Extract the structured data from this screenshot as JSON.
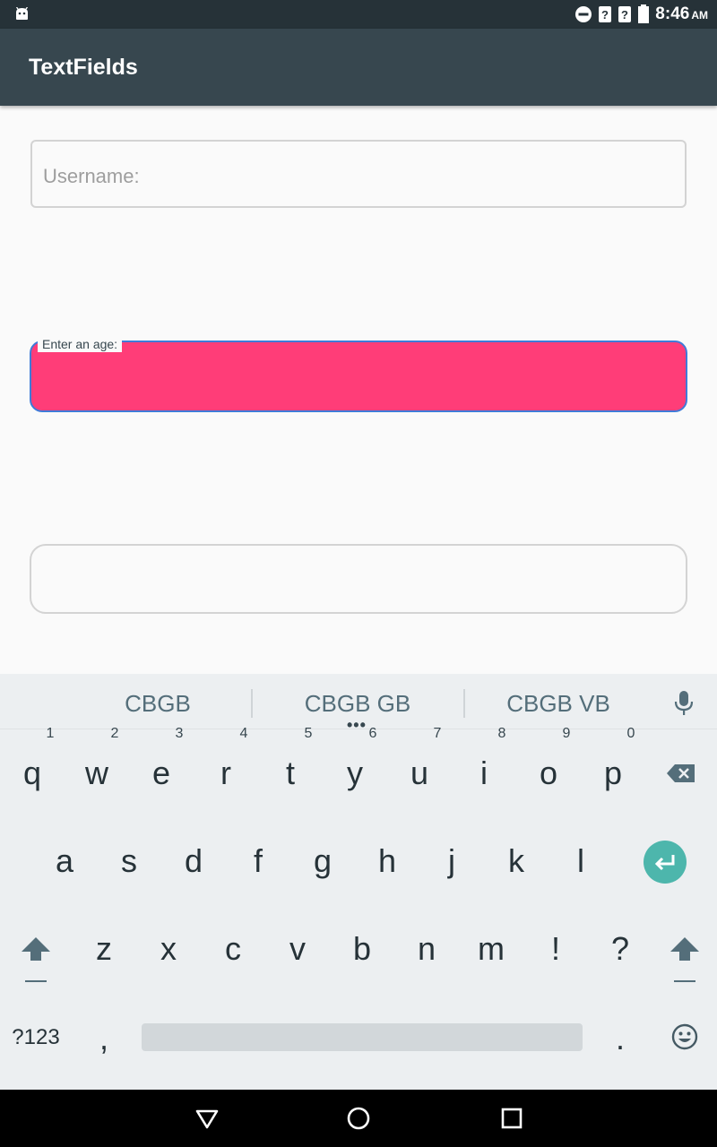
{
  "status_bar": {
    "time": "8:46",
    "ampm": "AM",
    "icons": [
      "android-icon",
      "do-not-disturb-icon",
      "no-signal-icon",
      "no-wifi-icon",
      "battery-icon"
    ]
  },
  "app_bar": {
    "title": "TextFields"
  },
  "fields": {
    "username_placeholder": "Username:",
    "age_label": "Enter an age:",
    "age_fill_color": "#ff3d78",
    "focus_border_color": "#3f7bd8"
  },
  "keyboard": {
    "suggestions": [
      "CBGB",
      "CBGB GB",
      "CBGB VB"
    ],
    "row1": [
      {
        "k": "q",
        "h": "1"
      },
      {
        "k": "w",
        "h": "2"
      },
      {
        "k": "e",
        "h": "3"
      },
      {
        "k": "r",
        "h": "4"
      },
      {
        "k": "t",
        "h": "5"
      },
      {
        "k": "y",
        "h": "6"
      },
      {
        "k": "u",
        "h": "7"
      },
      {
        "k": "i",
        "h": "8"
      },
      {
        "k": "o",
        "h": "9"
      },
      {
        "k": "p",
        "h": "0"
      }
    ],
    "row2": [
      "a",
      "s",
      "d",
      "f",
      "g",
      "h",
      "j",
      "k",
      "l"
    ],
    "row3": [
      "z",
      "x",
      "c",
      "v",
      "b",
      "n",
      "m",
      "!",
      "?"
    ],
    "symbols_key": "?123",
    "comma_key": ",",
    "period_key": ".",
    "enter_color": "#4db6ac"
  },
  "nav_bar": {
    "icons": [
      "back-icon",
      "home-icon",
      "recents-icon"
    ]
  }
}
